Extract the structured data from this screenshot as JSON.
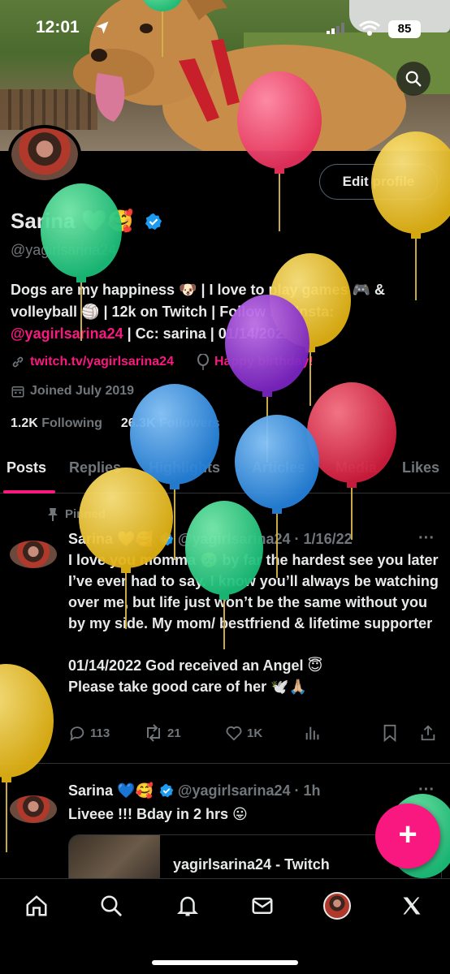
{
  "status_bar": {
    "time": "12:01",
    "battery": "85"
  },
  "profile": {
    "name": "Sarina 💚🥰",
    "handle": "@yagirlsarina24",
    "edit_label": "Edit profile",
    "bio_line1": "Dogs are my happiness 🐶 | I love to play games 🎮 & volleyball 🏐 | 12k on Twitch | Follow my Insta:",
    "bio_handle": "@yagirlsarina24",
    "bio_line2": " | Cc: sarina | 01/14/2022😇",
    "link": "twitch.tv/yagirlsarina24",
    "birthday": "Happy birthday!",
    "joined": "Joined July 2019",
    "following_count": "1.2K",
    "following_label": "Following",
    "followers_count": "26.3K",
    "followers_label": "Followers"
  },
  "tabs": [
    "Posts",
    "Replies",
    "Highlights",
    "Articles",
    "Media",
    "Likes"
  ],
  "posts": [
    {
      "pinned_label": "Pinned",
      "name": "Sarina 💛🥰",
      "handle": "@yagirlsarina24",
      "date": "· 1/16/22",
      "text": "I love you momma 🥺 by far the hardest see you later I’ve ever had to say. I know you’ll always be watching over me, but life just won’t be the same without you by my side. My mom/ bestfriend & lifetime supporter\n\n01/14/2022 God received an Angel 😇\nPlease take good care of her 🕊️🙏🏼",
      "replies": "113",
      "reposts": "21",
      "likes": "1K"
    },
    {
      "name": "Sarina 💙🥰",
      "handle": "@yagirlsarina24",
      "date": "· 1h",
      "text": "Liveee !!! Bday in 2 hrs 😛",
      "card_title": "yagirlsarina24 - Twitch"
    }
  ],
  "fab_label": "+",
  "colors": {
    "accent": "#f91880",
    "verified": "#1d9bf0",
    "text": "#e7e9ea",
    "muted": "#71767b"
  },
  "icons": [
    "search-icon",
    "location-arrow-icon",
    "signal-icon",
    "wifi-icon",
    "battery-icon",
    "verified-icon",
    "link-icon",
    "balloon-icon",
    "calendar-icon",
    "pin-icon",
    "reply-icon",
    "repost-icon",
    "like-icon",
    "views-icon",
    "bookmark-icon",
    "share-icon",
    "home-icon",
    "bell-icon",
    "mail-icon",
    "x-logo-icon"
  ]
}
